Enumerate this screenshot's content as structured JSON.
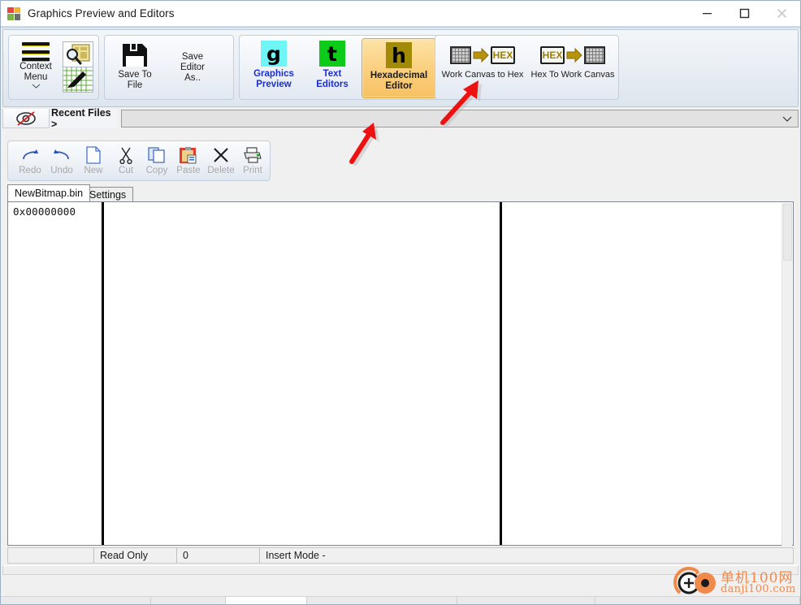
{
  "window": {
    "title": "Graphics Preview and Editors",
    "logo_icon": "app-squares-logo-icon",
    "controls": {
      "minimize": "minimize-icon",
      "maximize": "maximize-icon",
      "close": "close-icon"
    }
  },
  "ribbon": {
    "groups": [
      {
        "name": "context-menu-group",
        "buttons": [
          {
            "label_line1": "Context",
            "label_line2": "Menu",
            "icon": "hamburger-menu-icon",
            "style": "plain"
          },
          {
            "label_line1": "",
            "label_line2": "",
            "icon": "preview-paint-tile-icon",
            "style": "tile"
          }
        ]
      },
      {
        "name": "save-group",
        "buttons": [
          {
            "label_line1": "Save To",
            "label_line2": "File",
            "icon": "floppy-disk-save-icon",
            "style": "plain"
          },
          {
            "label_line1": "Save",
            "label_line2": "Editor",
            "label_line3": "As..",
            "icon": "none",
            "style": "plain"
          }
        ]
      },
      {
        "name": "editors-group",
        "buttons": [
          {
            "label_line1": "Graphics",
            "label_line2": "Preview",
            "icon": "letter-g-icon",
            "icon_bg": "#6ff5f5",
            "style": "blue"
          },
          {
            "label_line1": "Text",
            "label_line2": "Editors",
            "icon": "letter-t-icon",
            "icon_bg": "#0ccc19",
            "style": "blue"
          },
          {
            "label_line1": "Hexadecimal",
            "label_line2": "Editor",
            "icon": "letter-h-icon",
            "icon_bg": "#a08a06",
            "style": "selected"
          }
        ]
      },
      {
        "name": "conversion-group",
        "buttons": [
          {
            "label_line1": "Work Canvas to Hex",
            "icon": "canvas-arrow-hex-icon",
            "style": "wide"
          },
          {
            "label_line1": "Hex To Work Canvas",
            "icon": "hex-arrow-canvas-icon",
            "style": "wide"
          }
        ]
      }
    ],
    "hex_badge_text": "HEX"
  },
  "recent_files": {
    "eye_icon": "eye-hidden-icon",
    "label": "Recent Files >",
    "combo_value": "",
    "combo_placeholder": "",
    "chevron_icon": "chevron-down-icon"
  },
  "edit_toolbar": {
    "buttons": [
      {
        "label": "Redo",
        "icon": "redo-arrow-icon",
        "enabled": false
      },
      {
        "label": "Undo",
        "icon": "undo-arrow-icon",
        "enabled": false
      },
      {
        "label": "New",
        "icon": "new-page-icon",
        "enabled": false
      },
      {
        "label": "Cut",
        "icon": "scissors-icon",
        "enabled": false
      },
      {
        "label": "Copy",
        "icon": "copy-pages-icon",
        "enabled": false
      },
      {
        "label": "Paste",
        "icon": "clipboard-paste-icon",
        "enabled": false
      },
      {
        "label": "Delete",
        "icon": "x-delete-icon",
        "enabled": false
      },
      {
        "label": "Print",
        "icon": "printer-icon",
        "enabled": false
      }
    ]
  },
  "tabs": [
    {
      "label": "NewBitmap.bin",
      "active": true
    },
    {
      "label": "Settings",
      "active": false
    }
  ],
  "hex_editor": {
    "address_column": "0x00000000",
    "hex_bytes": "",
    "ascii_text": ""
  },
  "status_bar": {
    "cell_1": "",
    "cell_2": "Read Only",
    "cell_3": "0",
    "cell_4": "Insert Mode -"
  },
  "watermark": {
    "line1": "单机100网",
    "line2": "danji100.com",
    "icon": "danji-logo-icon",
    "color": "#f08a4b"
  },
  "annotations": [
    {
      "name": "red-arrow-annotation-1"
    },
    {
      "name": "red-arrow-annotation-2"
    }
  ],
  "colors": {
    "accent_blue": "#1b2ed0",
    "selected_orange": "#f7c163",
    "disabled_gray": "#a8a8a8"
  }
}
